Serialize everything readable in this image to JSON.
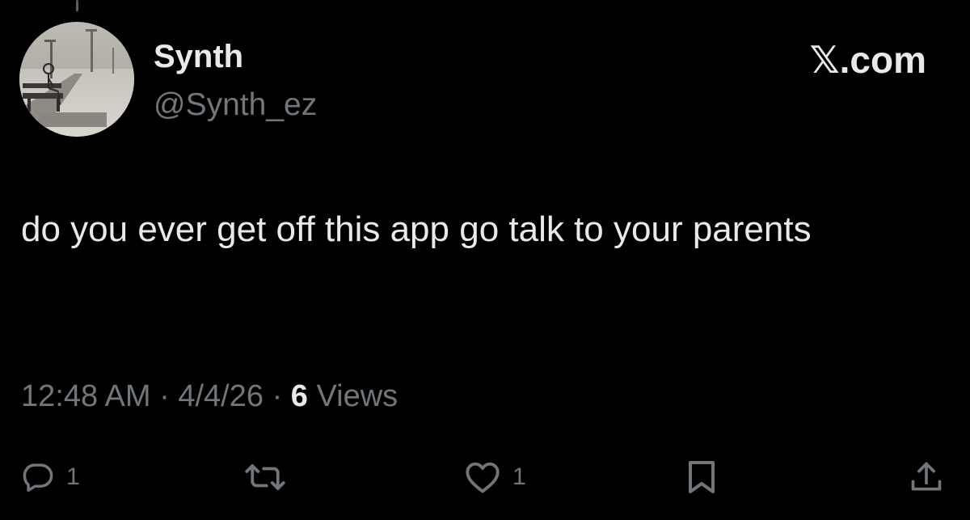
{
  "post": {
    "author": {
      "display_name": "Synth",
      "handle": "@Synth_ez"
    },
    "brand": "𝕏.com",
    "text": "do you ever get off this app go talk to your parents",
    "meta": {
      "time": "12:48 AM",
      "separator": "·",
      "date": "4/4/26",
      "views_count": "6",
      "views_label": "Views"
    },
    "actions": {
      "reply_count": "1",
      "like_count": "1"
    }
  },
  "icons": {
    "reply": "reply-icon",
    "repost": "repost-icon",
    "like": "heart-icon",
    "bookmark": "bookmark-icon",
    "share": "share-icon"
  },
  "colors": {
    "background": "#000000",
    "primary_text": "#e7e9ea",
    "secondary_text": "#71767b"
  }
}
